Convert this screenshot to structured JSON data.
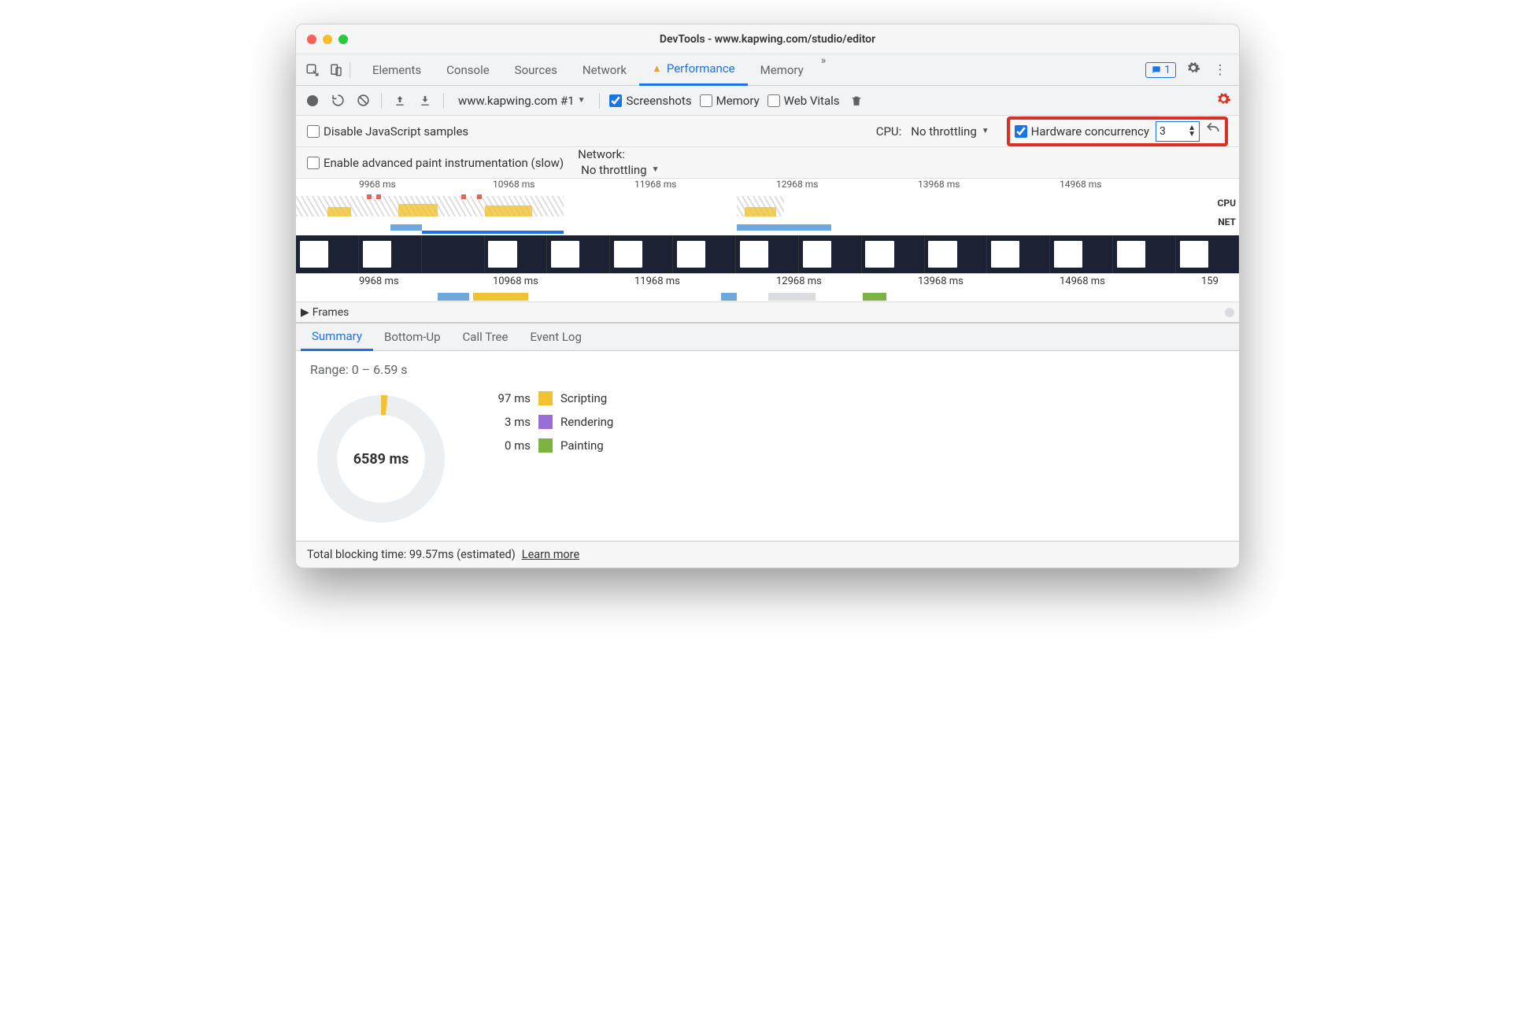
{
  "window": {
    "title": "DevTools - www.kapwing.com/studio/editor"
  },
  "tabs": {
    "items": [
      "Elements",
      "Console",
      "Sources",
      "Network",
      "Performance",
      "Memory"
    ],
    "active": "Performance",
    "overflow_glyph": "»",
    "messages_count": "1"
  },
  "toolbar": {
    "page_label": "www.kapwing.com #1",
    "screenshots_label": "Screenshots",
    "memory_label": "Memory",
    "webvitals_label": "Web Vitals"
  },
  "options1": {
    "disable_js_label": "Disable JavaScript samples",
    "cpu_label": "CPU:",
    "cpu_value": "No throttling",
    "hw_label": "Hardware concurrency",
    "hw_value": "3"
  },
  "options2": {
    "paint_label": "Enable advanced paint instrumentation (slow)",
    "net_label": "Network:",
    "net_value": "No throttling"
  },
  "timeline": {
    "ticks": [
      "9968 ms",
      "10968 ms",
      "11968 ms",
      "12968 ms",
      "13968 ms",
      "14968 ms"
    ],
    "cpu_label": "CPU",
    "net_label": "NET"
  },
  "detail": {
    "ticks": [
      "9968 ms",
      "10968 ms",
      "11968 ms",
      "12968 ms",
      "13968 ms",
      "14968 ms",
      "159"
    ],
    "frames_label": "Frames"
  },
  "bottom_tabs": {
    "items": [
      "Summary",
      "Bottom-Up",
      "Call Tree",
      "Event Log"
    ],
    "active": "Summary"
  },
  "summary": {
    "range": "Range: 0 – 6.59 s",
    "total": "6589 ms",
    "legend": [
      {
        "value": "97 ms",
        "label": "Scripting",
        "class": "sw-script"
      },
      {
        "value": "3 ms",
        "label": "Rendering",
        "class": "sw-render"
      },
      {
        "value": "0 ms",
        "label": "Painting",
        "class": "sw-paint"
      }
    ]
  },
  "footer": {
    "tbt_label": "Total blocking time: 99.57ms (estimated)",
    "learn_more": "Learn more"
  }
}
